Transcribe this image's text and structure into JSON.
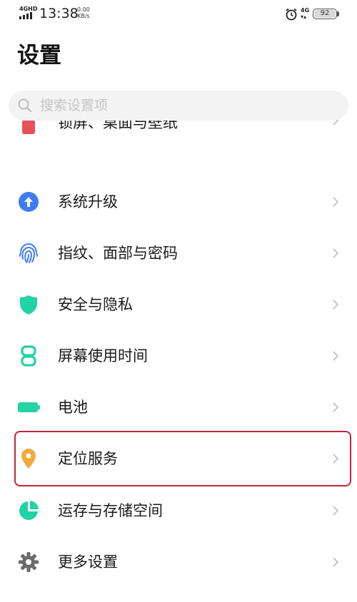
{
  "status_bar": {
    "network": "4GHD",
    "time": "13:38",
    "speed_value": "0.00",
    "speed_unit": "KB/s",
    "network_right": "4G",
    "battery": "92"
  },
  "page": {
    "title": "设置"
  },
  "search": {
    "placeholder": "搜索设置项"
  },
  "hidden_item": {
    "label": "锁屏、桌面与壁纸",
    "icon": "wallpaper-icon"
  },
  "menu": {
    "items": [
      {
        "label": "系统升级",
        "icon": "system-update-icon",
        "color": "#3d7cf2"
      },
      {
        "label": "指纹、面部与密码",
        "icon": "fingerprint-icon",
        "color": "#3d7cf2"
      },
      {
        "label": "安全与隐私",
        "icon": "shield-icon",
        "color": "#22d3a3"
      },
      {
        "label": "屏幕使用时间",
        "icon": "hourglass-icon",
        "color": "#22d3a3"
      },
      {
        "label": "电池",
        "icon": "battery-icon",
        "color": "#22d3a3"
      },
      {
        "label": "定位服务",
        "icon": "location-pin-icon",
        "color": "#f4a93b"
      },
      {
        "label": "运存与存储空间",
        "icon": "storage-pie-icon",
        "color": "#22d3a3"
      },
      {
        "label": "更多设置",
        "icon": "gear-icon",
        "color": "#666666"
      }
    ]
  },
  "colors": {
    "highlight": "#c0263a",
    "chevron": "#bdbdbd"
  }
}
